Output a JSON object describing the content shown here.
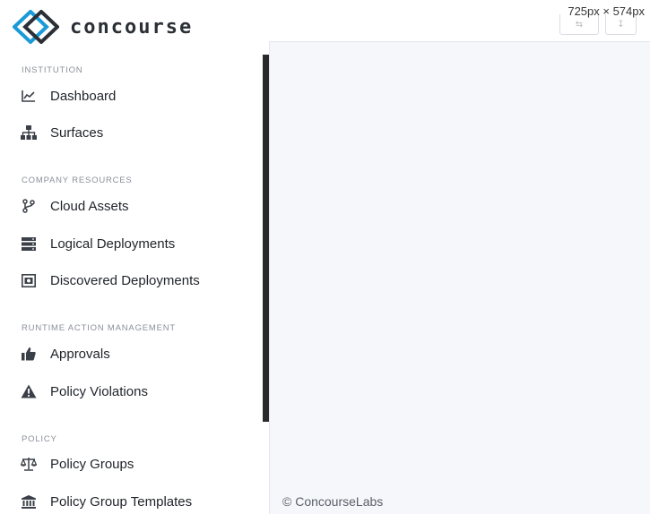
{
  "app": {
    "logo_text": "concourse",
    "screenshot_dims": "725px × 574px"
  },
  "sidebar": {
    "sections": [
      {
        "label": "INSTITUTION",
        "items": [
          {
            "label": "Dashboard",
            "icon": "chart-line-icon"
          },
          {
            "label": "Surfaces",
            "icon": "sitemap-icon"
          }
        ]
      },
      {
        "label": "COMPANY RESOURCES",
        "items": [
          {
            "label": "Cloud Assets",
            "icon": "code-branch-icon"
          },
          {
            "label": "Logical Deployments",
            "icon": "server-icon"
          },
          {
            "label": "Discovered Deployments",
            "icon": "scan-icon"
          }
        ]
      },
      {
        "label": "RUNTIME ACTION MANAGEMENT",
        "items": [
          {
            "label": "Approvals",
            "icon": "thumbs-up-icon"
          },
          {
            "label": "Policy Violations",
            "icon": "warning-icon"
          }
        ]
      },
      {
        "label": "POLICY",
        "items": [
          {
            "label": "Policy Groups",
            "icon": "balance-scale-icon"
          },
          {
            "label": "Policy Group Templates",
            "icon": "institution-icon"
          }
        ]
      }
    ]
  },
  "footer": {
    "copyright": "© ConcourseLabs"
  },
  "colors": {
    "brand_blue": "#1a9bd7",
    "brand_dark": "#2b2f36",
    "main_bg": "#f5f7fa",
    "scrollbar": "#2a2a2a"
  }
}
